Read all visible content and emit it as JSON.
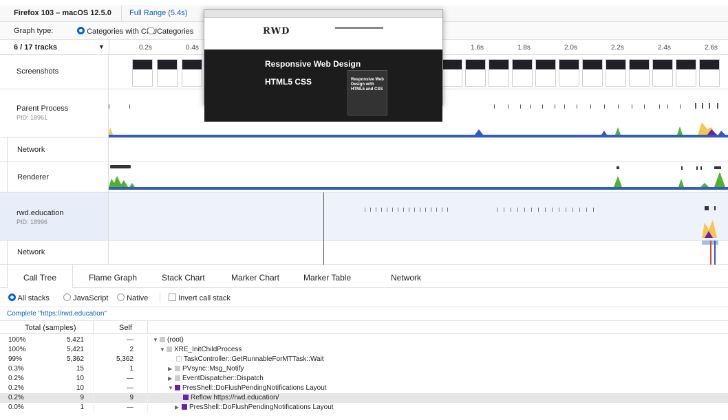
{
  "header": {
    "environment": "Firefox 103 – macOS 12.5.0",
    "range": "Full Range (5.4s)"
  },
  "graph_type": {
    "label": "Graph type:",
    "options": [
      "Categories with CPU",
      "Categories"
    ],
    "selected": "Categories with CPU"
  },
  "timeline": {
    "track_count": "6 / 17 tracks",
    "ticks": [
      "0.2s",
      "0.4s",
      "1.6s",
      "1.8s",
      "2.0s",
      "2.2s",
      "2.4s",
      "2.6s"
    ]
  },
  "tracks": {
    "screenshots": "Screenshots",
    "parent": {
      "name": "Parent Process",
      "pid": "PID: 18961"
    },
    "network1": "Network",
    "renderer": "Renderer",
    "rwd": {
      "name": "rwd.education",
      "pid": "PID: 18996"
    },
    "network2": "Network"
  },
  "preview": {
    "logo": "RWD",
    "hero_title": "Responsive Web Design",
    "hero_sub": "HTML5 CSS",
    "book_text": "Responsive Web Design with HTML5 and CSS"
  },
  "tabs": [
    "Call Tree",
    "Flame Graph",
    "Stack Chart",
    "Marker Chart",
    "Marker Table",
    "Network"
  ],
  "stack_options": {
    "all": "All stacks",
    "js": "JavaScript",
    "native": "Native",
    "invert": "Invert call stack"
  },
  "breadcrumb": "Complete \"https://rwd.education\"",
  "table": {
    "col_total": "Total (samples)",
    "col_self": "Self",
    "rows": [
      {
        "pct": "100%",
        "total": "5,421",
        "self": "—",
        "fn": "(root)"
      },
      {
        "pct": "100%",
        "total": "5,421",
        "self": "2",
        "fn": "XRE_InitChildProcess"
      },
      {
        "pct": "99%",
        "total": "5,362",
        "self": "5,362",
        "fn": "TaskController::GetRunnableForMTTask::Wait"
      },
      {
        "pct": "0.3%",
        "total": "15",
        "self": "1",
        "fn": "PVsync::Msg_Notify"
      },
      {
        "pct": "0.2%",
        "total": "10",
        "self": "—",
        "fn": "EventDispatcher::Dispatch"
      },
      {
        "pct": "0.2%",
        "total": "10",
        "self": "—",
        "fn": "PresShell::DoFlushPendingNotifications Layout"
      },
      {
        "pct": "0.2%",
        "total": "9",
        "self": "9",
        "fn": "Reflow https://rwd.education/"
      },
      {
        "pct": "0.0%",
        "total": "1",
        "self": "—",
        "fn": "PresShell::DoFlushPendingNotifications Layout"
      }
    ]
  },
  "colors": {
    "accent": "#0060df",
    "cpu_blue": "#2f5bc4",
    "layout_purple": "#6b1fb5",
    "idle_gray": "#cccccc",
    "js_yellow": "#f5c84c",
    "graphics_green": "#4fb32a"
  }
}
